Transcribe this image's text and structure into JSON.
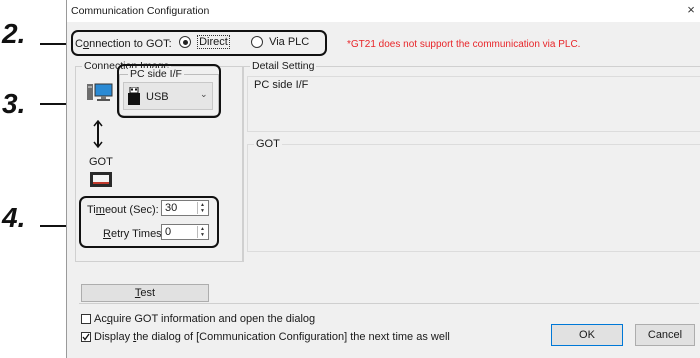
{
  "annotations": {
    "step2": "2.",
    "step3": "3.",
    "step4": "4."
  },
  "window": {
    "title": "Communication Configuration",
    "close_symbol": "×"
  },
  "connection": {
    "label_pre": "C",
    "label_u": "o",
    "label_post": "nnection to GOT:",
    "direct_label": "Direct",
    "via_plc_label": "Via PLC",
    "selected": "Direct",
    "note": "*GT21 does not support the communication via PLC."
  },
  "image_group": {
    "title": "Connection Image",
    "pc_if_label": "PC side I/F",
    "pc_if_value": "USB",
    "got_label": "GOT"
  },
  "detail": {
    "title": "Detail Setting",
    "pc_if_title": "PC side I/F",
    "got_title": "GOT"
  },
  "timeout": {
    "label_pre": "Ti",
    "label_u": "m",
    "label_post": "eout (Sec):",
    "value": "30"
  },
  "retry": {
    "label_u": "R",
    "label_post": "etry Times:",
    "value": "0"
  },
  "test_button": {
    "label_u": "T",
    "label_post": "est"
  },
  "acquire": {
    "label_pre": "Ac",
    "label_u": "q",
    "label_post": "uire GOT information and open the dialog",
    "checked": false
  },
  "display_dialog": {
    "label_pre": "Display ",
    "label_u": "t",
    "label_post": "he dialog of [Communication Configuration] the next time as well",
    "checked": true
  },
  "ok_button": "OK",
  "cancel_button": "Cancel",
  "colors": {
    "note_red": "#e8262a",
    "default_button_border": "#0078d7",
    "dialog_bg": "#f0f0f0"
  }
}
